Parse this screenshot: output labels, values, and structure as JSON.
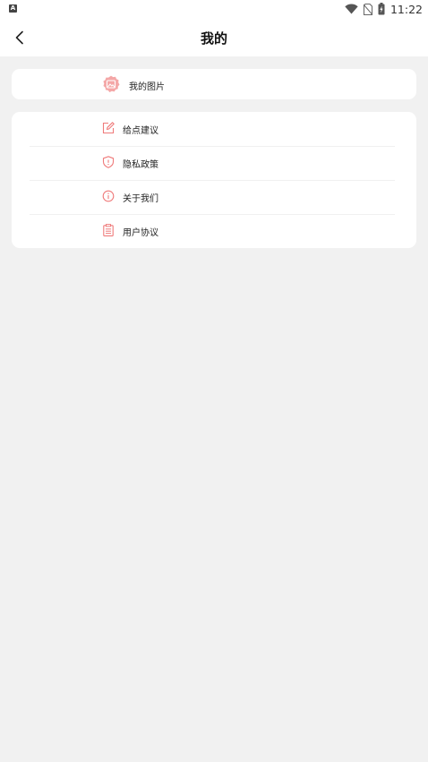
{
  "status_bar": {
    "notification_icon": "A",
    "time": "11:22",
    "icons": [
      "wifi-icon",
      "no-sim-icon",
      "battery-charging-icon"
    ]
  },
  "header": {
    "title": "我的",
    "back_icon": "chevron-left-icon"
  },
  "colors": {
    "accent": "#ef7b7b",
    "background": "#f1f1f1",
    "card": "#ffffff"
  },
  "my_pictures": {
    "label": "我的图片",
    "icon": "photo-icon"
  },
  "menu": [
    {
      "label": "给点建议",
      "icon": "edit-icon"
    },
    {
      "label": "隐私政策",
      "icon": "shield-icon"
    },
    {
      "label": "关于我们",
      "icon": "info-icon"
    },
    {
      "label": "用户协议",
      "icon": "clipboard-icon"
    }
  ]
}
